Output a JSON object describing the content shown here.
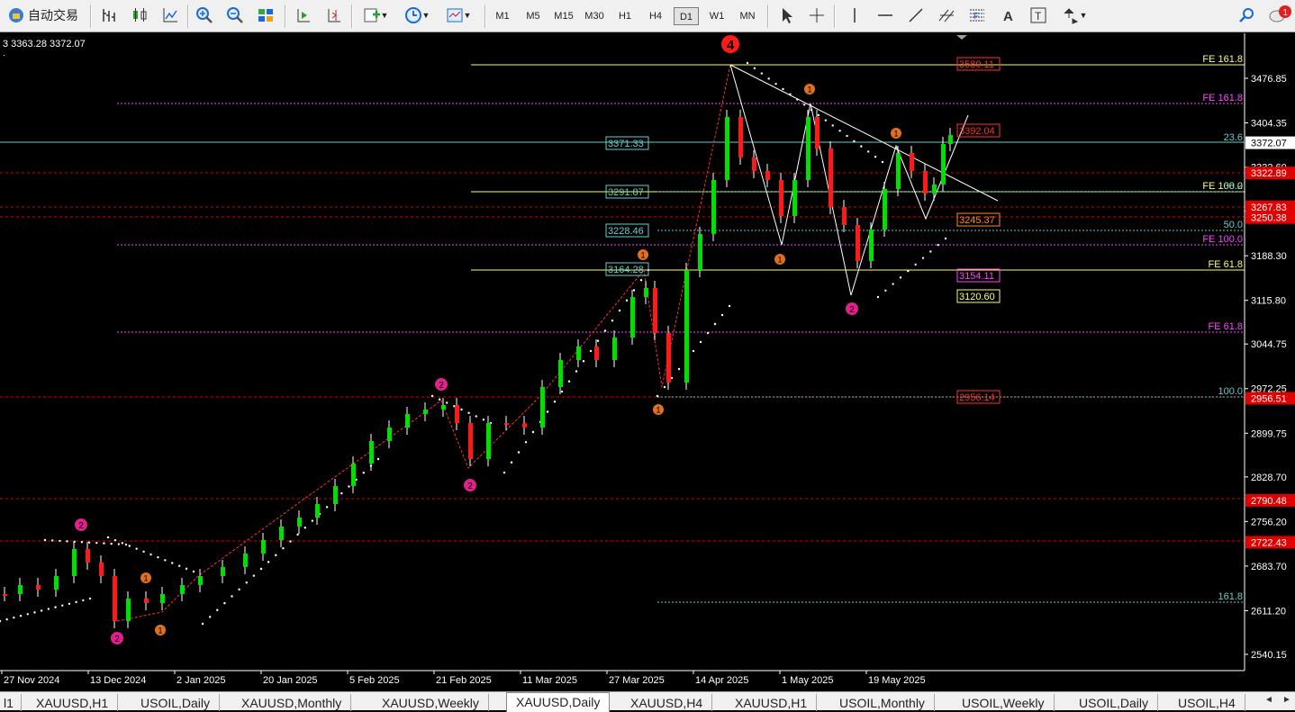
{
  "toolbar": {
    "autotrade_label": "自动交易",
    "timeframes": [
      "M1",
      "M5",
      "M15",
      "M30",
      "H1",
      "H4",
      "D1",
      "W1",
      "MN"
    ],
    "active_timeframe": "D1",
    "notification_count": "1"
  },
  "chart": {
    "info_text": "3 3363.28 3372.07",
    "wave4_label": "4",
    "price_axis": [
      "3476.85",
      "3404.35",
      "3332.60",
      "3260.85",
      "3188.30",
      "3115.80",
      "3044.75",
      "2972.25",
      "2899.75",
      "2828.70",
      "2756.20",
      "2683.70",
      "2611.20",
      "2540.15"
    ],
    "current_price": "3372.07",
    "date_axis": [
      "27 Nov 2024",
      "13 Dec 2024",
      "2 Jan 2025",
      "20 Jan 2025",
      "5 Feb 2025",
      "21 Feb 2025",
      "11 Mar 2025",
      "27 Mar 2025",
      "14 Apr 2025",
      "1 May 2025",
      "19 May 2025"
    ],
    "axis_tags": [
      {
        "text": "3322.89",
        "color": "#e00000"
      },
      {
        "text": "3267.83",
        "color": "#e00000"
      },
      {
        "text": "3250.38",
        "color": "#e00000"
      },
      {
        "text": "2956.51",
        "color": "#e00000"
      },
      {
        "text": "2790.48",
        "color": "#e00000"
      },
      {
        "text": "2722.43",
        "color": "#e00000"
      }
    ],
    "level_labels": [
      {
        "text": "FE 161.8",
        "color": "#ffff66"
      },
      {
        "text": "FE 161.8",
        "color": "#ff44ff"
      },
      {
        "text": "23.6",
        "color": "#66cccc"
      },
      {
        "text": "FE 100.0",
        "color": "#ffff66"
      },
      {
        "text": "38.2",
        "color": "#66cccc"
      },
      {
        "text": "50.0",
        "color": "#66cccc"
      },
      {
        "text": "FE 100.0",
        "color": "#ff44ff"
      },
      {
        "text": "FE 61.8",
        "color": "#ffff66"
      },
      {
        "text": "FE 61.8",
        "color": "#ff44ff"
      },
      {
        "text": "100.0",
        "color": "#66cccc"
      },
      {
        "text": "161.8",
        "color": "#66cccc"
      }
    ],
    "price_boxes": [
      {
        "text": "3580.11",
        "color": "#ff3030"
      },
      {
        "text": "3392.04",
        "color": "#ff3030"
      },
      {
        "text": "3245.37",
        "color": "#ff8c1a"
      },
      {
        "text": "3154.11",
        "color": "#ff44ff"
      },
      {
        "text": "3120.60",
        "color": "#ffff66"
      },
      {
        "text": "2956.14",
        "color": "#ff3030"
      },
      {
        "text": "3371.33",
        "color": "#66cccc"
      },
      {
        "text": "3291.87",
        "color": "#66cccc"
      },
      {
        "text": "3228.46",
        "color": "#66cccc"
      },
      {
        "text": "3164.28",
        "color": "#66cccc"
      }
    ],
    "wave_labels_orange": [
      "1",
      "1",
      "1",
      "1",
      "1",
      "1",
      "1"
    ],
    "wave_labels_magenta": [
      "2",
      "2",
      "2",
      "2",
      "2"
    ],
    "colors": {
      "bull": "#00e000",
      "bear": "#ff1a1a",
      "background": "#000000"
    }
  },
  "tabs": {
    "first_partial": "l1",
    "items": [
      "XAUUSD,H1",
      "USOIL,Daily",
      "XAUUSD,Monthly",
      "XAUUSD,Weekly",
      "XAUUSD,Daily",
      "XAUUSD,H4",
      "XAUUSD,H1",
      "USOIL,Monthly",
      "USOIL,Weekly",
      "USOIL,Daily",
      "USOIL,H4"
    ],
    "active": "XAUUSD,Daily"
  }
}
